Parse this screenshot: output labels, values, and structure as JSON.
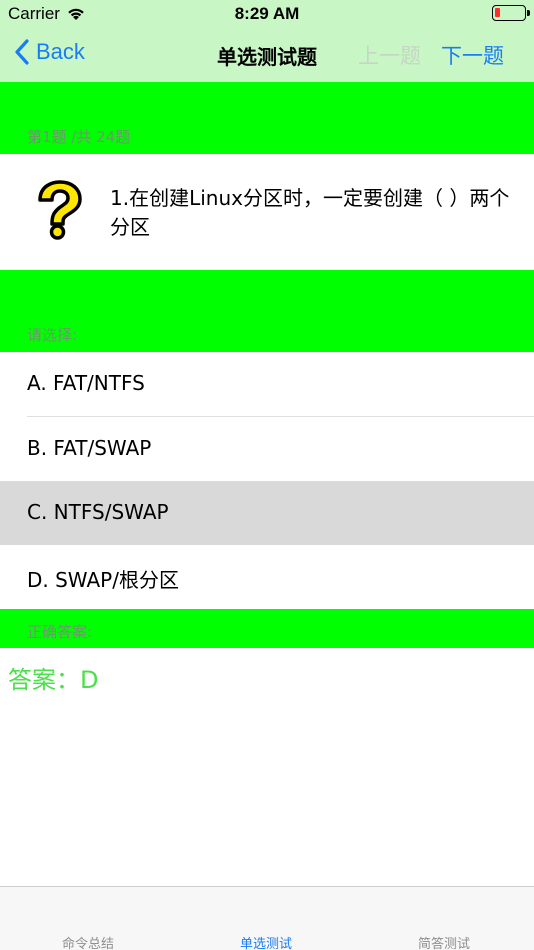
{
  "status_bar": {
    "carrier": "Carrier",
    "time": "8:29 AM"
  },
  "nav": {
    "back_label": "Back",
    "title": "单选测试题",
    "prev_label": "上一题",
    "next_label": "下一题"
  },
  "question": {
    "counter": "第1题 /共 24题",
    "text": "1.在创建Linux分区时，一定要创建（ ）两个分区",
    "icon": "question-mark-icon"
  },
  "choices": {
    "prompt": "请选择:",
    "options": [
      {
        "label": "A. FAT/NTFS",
        "selected": false
      },
      {
        "label": "B. FAT/SWAP",
        "selected": false
      },
      {
        "label": "C. NTFS/SWAP",
        "selected": true
      },
      {
        "label": "D. SWAP/根分区",
        "selected": false
      }
    ]
  },
  "answer": {
    "header": "正确答案:",
    "text": "答案：D"
  },
  "tabs": [
    {
      "label": "命令总结",
      "active": false
    },
    {
      "label": "单选测试",
      "active": true
    },
    {
      "label": "简答测试",
      "active": false
    }
  ],
  "colors": {
    "accent": "#1a7cf5",
    "band": "#00ff00",
    "header_bg": "#c8f7c5",
    "answer": "#4ce04c"
  }
}
